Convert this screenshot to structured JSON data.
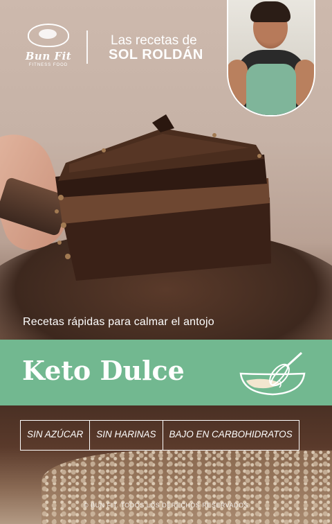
{
  "brand": {
    "name": "Bun Fit",
    "tagline": "FITNESS FOOD"
  },
  "header": {
    "intro": "Las recetas de",
    "author": "SOL ROLDÁN"
  },
  "subtitle": "Recetas rápidas para calmar el antojo",
  "title": "Keto Dulce",
  "tags": [
    "SIN AZÚCAR",
    "SIN HARINAS",
    "BAJO EN CARBOHIDRATOS"
  ],
  "footer": "© BUN FIT. TODOS LOS DERECHOS RESERVADOS",
  "icons": {
    "logo": "bun-fit-logo-icon",
    "bowl": "mixing-bowl-whisk-icon"
  },
  "colors": {
    "accent_green": "#72b890",
    "text": "#ffffff"
  }
}
